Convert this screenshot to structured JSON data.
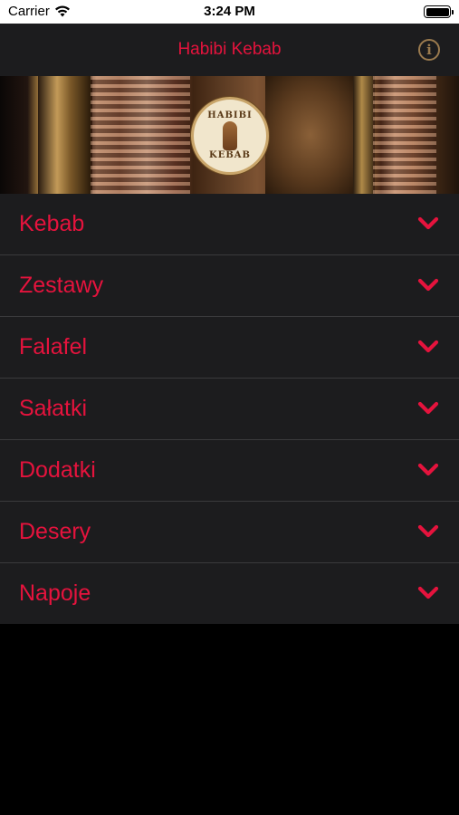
{
  "status_bar": {
    "carrier": "Carrier",
    "time": "3:24 PM",
    "icons": [
      "wifi-icon",
      "battery-icon"
    ]
  },
  "nav": {
    "title": "Habibi Kebab",
    "info_icon": "info-icon"
  },
  "banner": {
    "logo_top": "HABIBI",
    "logo_bottom": "KEBAB"
  },
  "menu": {
    "items": [
      {
        "label": "Kebab"
      },
      {
        "label": "Zestawy"
      },
      {
        "label": "Falafel"
      },
      {
        "label": "Sałatki"
      },
      {
        "label": "Dodatki"
      },
      {
        "label": "Desery"
      },
      {
        "label": "Napoje"
      }
    ],
    "expand_icon": "chevron-down-icon"
  },
  "colors": {
    "accent": "#e5133d",
    "nav_background": "#1c1c1e",
    "info_icon": "#9a7a4e",
    "page_background": "#000000"
  }
}
